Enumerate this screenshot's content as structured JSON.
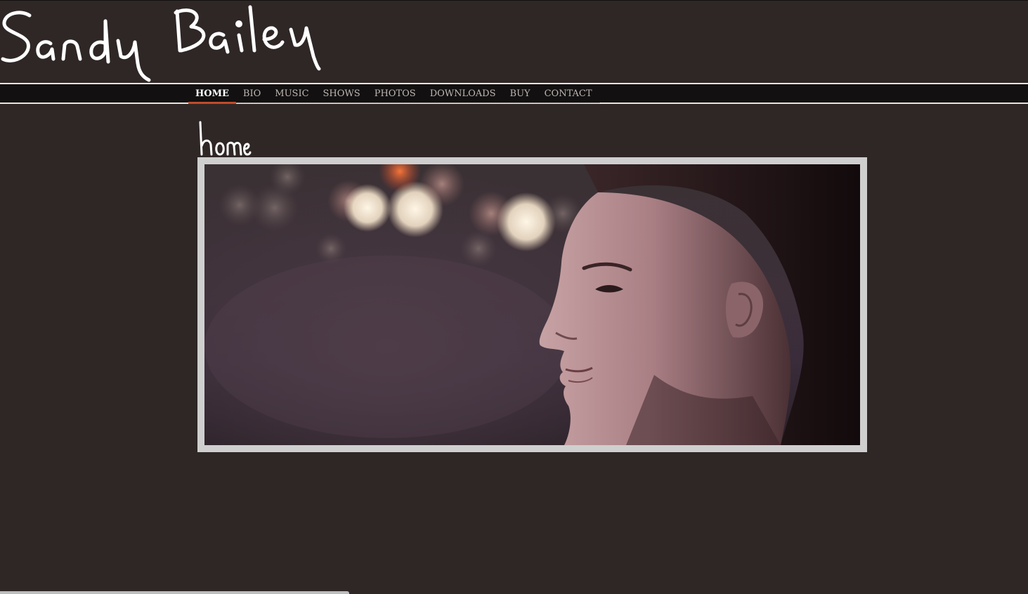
{
  "site": {
    "logo_text": "Sandy Bailey"
  },
  "nav": {
    "items": [
      {
        "label": "HOME",
        "active": true
      },
      {
        "label": "BIO",
        "active": false
      },
      {
        "label": "MUSIC",
        "active": false
      },
      {
        "label": "SHOWS",
        "active": false
      },
      {
        "label": "PHOTOS",
        "active": false
      },
      {
        "label": "DOWNLOADS",
        "active": false
      },
      {
        "label": "BUY",
        "active": false
      },
      {
        "label": "CONTACT",
        "active": false
      }
    ]
  },
  "main": {
    "heading": "home",
    "hero_image": "portrait-photo"
  },
  "colors": {
    "background": "#2e2726",
    "nav_background": "#121010",
    "nav_active_underline": "#c24a2a",
    "frame": "#cfcfcf"
  }
}
